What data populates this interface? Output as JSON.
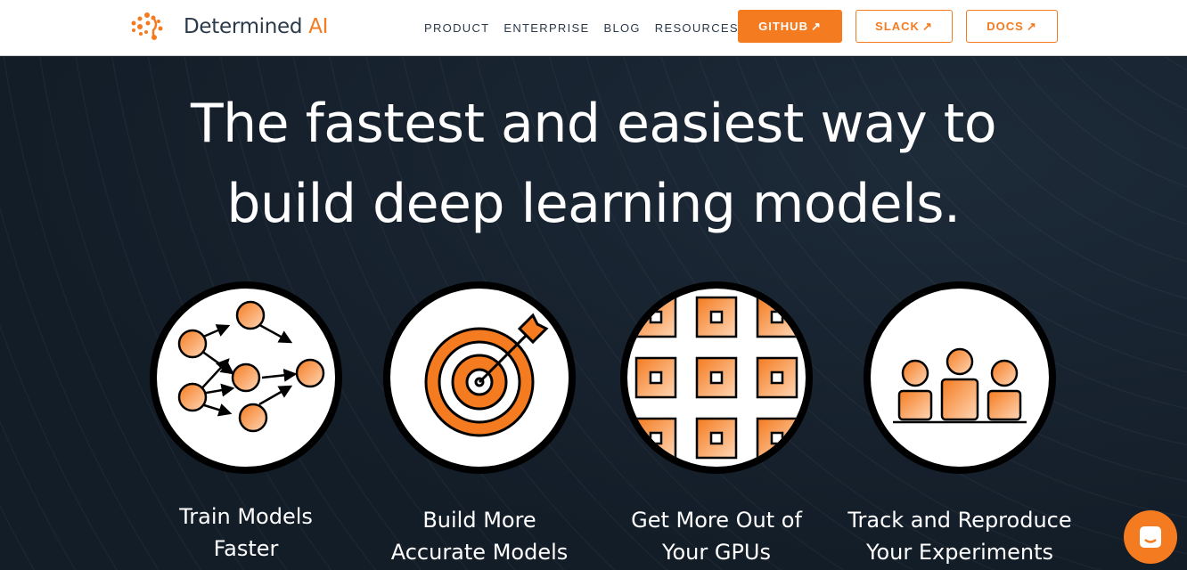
{
  "brand": {
    "name": "Determined",
    "suffix": "AI",
    "accent": "#f47b20",
    "dark": "#16212d"
  },
  "nav": {
    "links": [
      "PRODUCT",
      "ENTERPRISE",
      "BLOG",
      "RESOURCES"
    ],
    "buttons": [
      {
        "label": "GITHUB",
        "icon": "external-link-icon"
      },
      {
        "label": "SLACK",
        "icon": "external-link-icon"
      },
      {
        "label": "DOCS",
        "icon": "external-link-icon"
      }
    ]
  },
  "hero": {
    "title_line1": "The fastest and easiest way to",
    "title_line2": "build deep learning models."
  },
  "features": [
    {
      "line1": "Train Models",
      "line2": "Faster",
      "icon": "neural-network-icon"
    },
    {
      "line1": "Build More",
      "line2": "Accurate Models",
      "icon": "target-icon"
    },
    {
      "line1": "Get More Out of",
      "line2": "Your GPUs",
      "icon": "gpu-chips-icon"
    },
    {
      "line1": "Track and Reproduce",
      "line2": "Your Experiments",
      "icon": "team-icon"
    }
  ],
  "chat": {
    "icon": "chat-icon"
  }
}
